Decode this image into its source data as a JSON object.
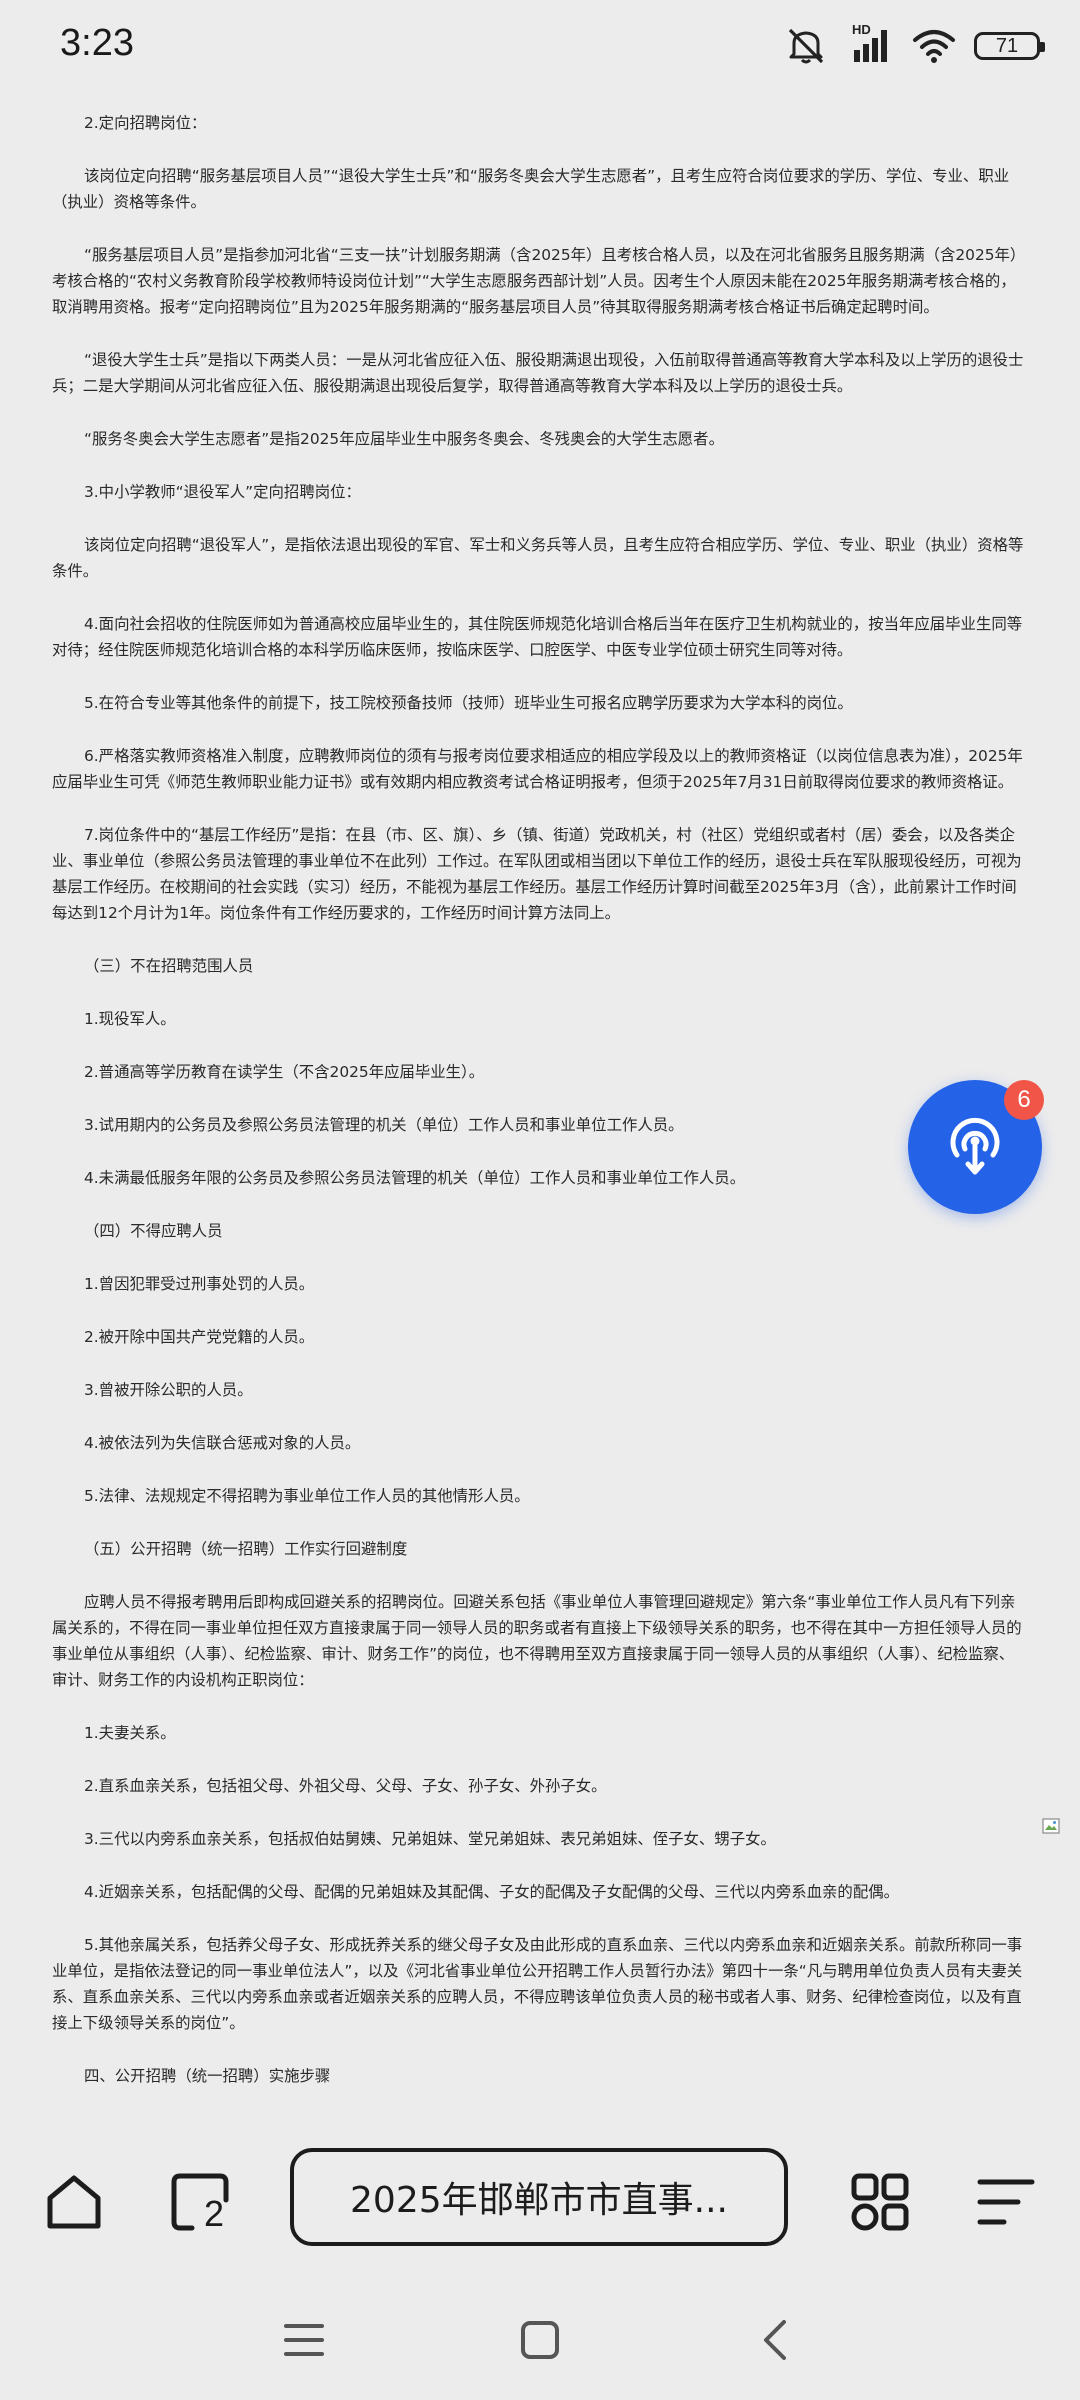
{
  "status_bar": {
    "time": "3:23",
    "network_label": "HD",
    "battery": "71"
  },
  "article": {
    "paragraphs": [
      "2.定向招聘岗位：",
      "该岗位定向招聘“服务基层项目人员”“退役大学生士兵”和“服务冬奥会大学生志愿者”，且考生应符合岗位要求的学历、学位、专业、职业（执业）资格等条件。",
      "“服务基层项目人员”是指参加河北省“三支一扶”计划服务期满（含2025年）且考核合格人员，以及在河北省服务且服务期满（含2025年）考核合格的“农村义务教育阶段学校教师特设岗位计划”“大学生志愿服务西部计划”人员。因考生个人原因未能在2025年服务期满考核合格的，取消聘用资格。报考“定向招聘岗位”且为2025年服务期满的“服务基层项目人员”待其取得服务期满考核合格证书后确定起聘时间。",
      "“退役大学生士兵”是指以下两类人员：一是从河北省应征入伍、服役期满退出现役，入伍前取得普通高等教育大学本科及以上学历的退役士兵；二是大学期间从河北省应征入伍、服役期满退出现役后复学，取得普通高等教育大学本科及以上学历的退役士兵。",
      "“服务冬奥会大学生志愿者”是指2025年应届毕业生中服务冬奥会、冬残奥会的大学生志愿者。",
      "3.中小学教师“退役军人”定向招聘岗位：",
      "该岗位定向招聘“退役军人”，是指依法退出现役的军官、军士和义务兵等人员，且考生应符合相应学历、学位、专业、职业（执业）资格等条件。",
      "4.面向社会招收的住院医师如为普通高校应届毕业生的，其住院医师规范化培训合格后当年在医疗卫生机构就业的，按当年应届毕业生同等对待；经住院医师规范化培训合格的本科学历临床医师，按临床医学、口腔医学、中医专业学位硕士研究生同等对待。",
      "5.在符合专业等其他条件的前提下，技工院校预备技师（技师）班毕业生可报名应聘学历要求为大学本科的岗位。",
      "6.严格落实教师资格准入制度，应聘教师岗位的须有与报考岗位要求相适应的相应学段及以上的教师资格证（以岗位信息表为准），2025年应届毕业生可凭《师范生教师职业能力证书》或有效期内相应教资考试合格证明报考，但须于2025年7月31日前取得岗位要求的教师资格证。",
      "7.岗位条件中的“基层工作经历”是指：在县（市、区、旗）、乡（镇、街道）党政机关，村（社区）党组织或者村（居）委会，以及各类企业、事业单位（参照公务员法管理的事业单位不在此列）工作过。在军队团或相当团以下单位工作的经历，退役士兵在军队服现役经历，可视为基层工作经历。在校期间的社会实践（实习）经历，不能视为基层工作经历。基层工作经历计算时间截至2025年3月（含），此前累计工作时间每达到12个月计为1年。岗位条件有工作经历要求的，工作经历时间计算方法同上。",
      "（三）不在招聘范围人员",
      "1.现役军人。",
      "2.普通高等学历教育在读学生（不含2025年应届毕业生）。",
      "3.试用期内的公务员及参照公务员法管理的机关（单位）工作人员和事业单位工作人员。",
      "4.未满最低服务年限的公务员及参照公务员法管理的机关（单位）工作人员和事业单位工作人员。",
      "（四）不得应聘人员",
      "1.曾因犯罪受过刑事处罚的人员。",
      "2.被开除中国共产党党籍的人员。",
      "3.曾被开除公职的人员。",
      "4.被依法列为失信联合惩戒对象的人员。",
      "5.法律、法规规定不得招聘为事业单位工作人员的其他情形人员。",
      "（五）公开招聘（统一招聘）工作实行回避制度",
      "应聘人员不得报考聘用后即构成回避关系的招聘岗位。回避关系包括《事业单位人事管理回避规定》第六条“事业单位工作人员凡有下列亲属关系的，不得在同一事业单位担任双方直接隶属于同一领导人员的职务或者有直接上下级领导关系的职务，也不得在其中一方担任领导人员的事业单位从事组织（人事）、纪检监察、审计、财务工作”的岗位，也不得聘用至双方直接隶属于同一领导人员的从事组织（人事）、纪检监察、审计、财务工作的内设机构正职岗位：",
      "1.夫妻关系。",
      "2.直系血亲关系，包括祖父母、外祖父母、父母、子女、孙子女、外孙子女。",
      "3.三代以内旁系血亲关系，包括叔伯姑舅姨、兄弟姐妹、堂兄弟姐妹、表兄弟姐妹、侄子女、甥子女。",
      "4.近姻亲关系，包括配偶的父母、配偶的兄弟姐妹及其配偶、子女的配偶及子女配偶的父母、三代以内旁系血亲的配偶。",
      "5.其他亲属关系，包括养父母子女、形成抚养关系的继父母子女及由此形成的直系血亲、三代以内旁系血亲和近姻亲关系。前款所称同一事业单位，是指依法登记的同一事业单位法人”，以及《河北省事业单位公开招聘工作人员暂行办法》第四十一条“凡与聘用单位负责人员有夫妻关系、直系血亲关系、三代以内旁系血亲或者近姻亲关系的应聘人员，不得应聘该单位负责人员的秘书或者人事、财务、纪律检查岗位，以及有直接上下级领导关系的岗位”。",
      "四、公开招聘（统一招聘）实施步骤"
    ]
  },
  "fab": {
    "icon": "podcast-icon",
    "badge": "6",
    "color": "#2462e8",
    "badge_color": "#f05548"
  },
  "bottom_bar": {
    "home_icon": "home-icon",
    "tabs_icon": "tabs-icon",
    "tab_count": "2",
    "address_text": "2025年邯郸市市直事...",
    "apps_icon": "apps-grid-icon",
    "menu_icon": "menu-icon"
  },
  "system_nav": {
    "recents_icon": "recents-icon",
    "home_icon": "system-home-icon",
    "back_icon": "back-icon"
  }
}
